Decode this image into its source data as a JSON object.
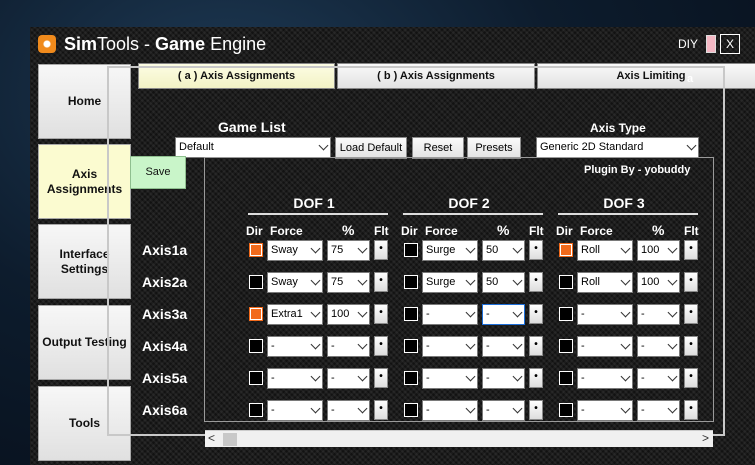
{
  "window": {
    "title_strong1": "Sim",
    "title_mid": "Tools - ",
    "title_strong2": "Game",
    "title_end": " Engine",
    "diy": "DIY",
    "close": "X"
  },
  "nav": {
    "home": "Home",
    "axis": "Axis Assignments",
    "interface": "Interface Settings",
    "output": "Output Testing",
    "tools": "Tools"
  },
  "tabs": [
    "( a ) Axis Assignments",
    "( b ) Axis Assignments",
    "Axis Limiting"
  ],
  "panel_corner": "a",
  "game_list": {
    "label": "Game List",
    "value": "Default"
  },
  "buttons": {
    "load_default": "Load Default",
    "reset": "Reset",
    "presets": "Presets",
    "save": "Save"
  },
  "axis_type": {
    "label": "Axis Type",
    "value": "Generic 2D Standard"
  },
  "plugin_by": "Plugin By - yobuddy",
  "dofs": [
    "DOF 1",
    "DOF 2",
    "DOF 3"
  ],
  "headers": {
    "dir": "Dir",
    "force": "Force",
    "pct": "%",
    "flt": "Flt"
  },
  "flt_glyph": "•",
  "rows": [
    {
      "label": "Axis1a",
      "d1": [
        "Sway",
        "75"
      ],
      "d2": [
        "Surge",
        "50"
      ],
      "d3": [
        "Roll",
        "100"
      ],
      "dir": [
        true,
        false,
        true
      ]
    },
    {
      "label": "Axis2a",
      "d1": [
        "Sway",
        "75"
      ],
      "d2": [
        "Surge",
        "50"
      ],
      "d3": [
        "Roll",
        "100"
      ],
      "dir": [
        false,
        false,
        false
      ]
    },
    {
      "label": "Axis3a",
      "d1": [
        "Extra1",
        "100"
      ],
      "d2": [
        "-",
        "-"
      ],
      "d3": [
        "-",
        "-"
      ],
      "dir": [
        true,
        false,
        false
      ]
    },
    {
      "label": "Axis4a",
      "d1": [
        "-",
        "-"
      ],
      "d2": [
        "-",
        "-"
      ],
      "d3": [
        "-",
        "-"
      ],
      "dir": [
        false,
        false,
        false
      ]
    },
    {
      "label": "Axis5a",
      "d1": [
        "-",
        "-"
      ],
      "d2": [
        "-",
        "-"
      ],
      "d3": [
        "-",
        "-"
      ],
      "dir": [
        false,
        false,
        false
      ]
    },
    {
      "label": "Axis6a",
      "d1": [
        "-",
        "-"
      ],
      "d2": [
        "-",
        "-"
      ],
      "d3": [
        "-",
        "-"
      ],
      "dir": [
        false,
        false,
        false
      ]
    }
  ],
  "scroll": {
    "left": "<",
    "right": ">"
  },
  "colors": {
    "dir_on": "#f26a1b",
    "active_nav": "#fbfbd0",
    "save": "#c9f5c9"
  }
}
